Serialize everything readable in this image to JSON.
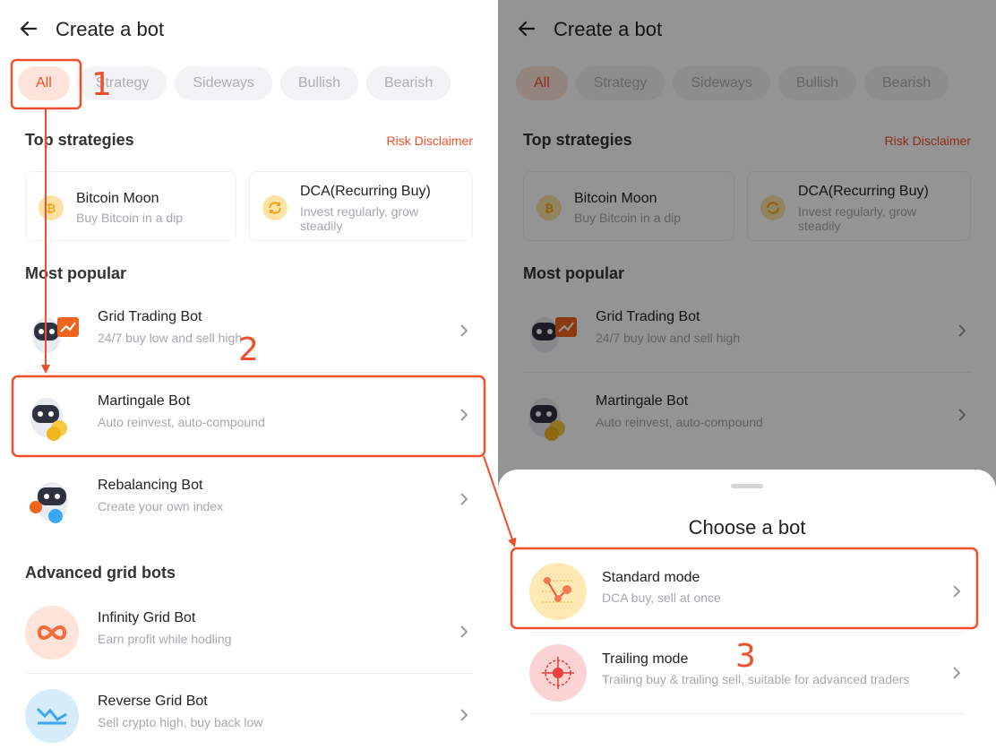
{
  "header": {
    "title": "Create a bot"
  },
  "filters": [
    "All",
    "Strategy",
    "Sideways",
    "Bullish",
    "Bearish"
  ],
  "top_strategies": {
    "title": "Top strategies",
    "risk_link": "Risk Disclaimer",
    "cards": [
      {
        "name": "Bitcoin Moon",
        "desc": "Buy Bitcoin in a dip",
        "icon": "bitcoin-icon"
      },
      {
        "name": "DCA(Recurring Buy)",
        "desc_line1": "Invest regularly, grow",
        "desc_line2": "steadily",
        "icon": "recurring-icon"
      }
    ]
  },
  "most_popular": {
    "title": "Most popular",
    "items": [
      {
        "name": "Grid Trading Bot",
        "desc": "24/7 buy low and sell high",
        "icon": "grid-robot-icon"
      },
      {
        "name": "Martingale Bot",
        "desc": "Auto reinvest, auto-compound",
        "icon": "martingale-robot-icon"
      },
      {
        "name": "Rebalancing Bot",
        "desc": "Create your own index",
        "icon": "rebalancing-robot-icon"
      }
    ]
  },
  "advanced": {
    "title": "Advanced grid bots",
    "items": [
      {
        "name": "Infinity Grid Bot",
        "desc": "Earn profit while hodling",
        "icon": "infinity-icon"
      },
      {
        "name": "Reverse Grid Bot",
        "desc": "Sell crypto high, buy back low",
        "icon": "reverse-chart-icon"
      }
    ]
  },
  "sheet": {
    "title": "Choose a bot",
    "modes": [
      {
        "name": "Standard mode",
        "desc": "DCA buy, sell at once",
        "icon": "standard-chart-icon"
      },
      {
        "name": "Trailing mode",
        "desc": "Trailing buy & trailing sell, suitable for advanced traders",
        "icon": "target-icon"
      }
    ]
  },
  "annotations": {
    "step1": "1",
    "step2": "2",
    "step3": "3"
  },
  "colors": {
    "accent": "#ef4f2b",
    "chip_active_bg": "#fde3da",
    "overlay": "rgba(0,0,0,0.42)"
  }
}
